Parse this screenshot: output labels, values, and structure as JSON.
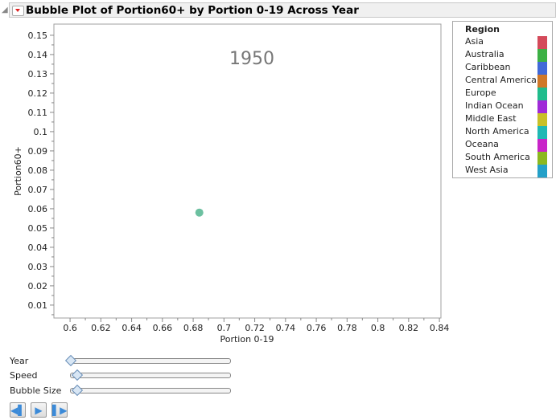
{
  "header": {
    "title": "Bubble Plot of Portion60+  by Portion 0-19 Across Year"
  },
  "chart_data": {
    "type": "scatter",
    "title": "Bubble Plot of Portion60+  by Portion 0-19 Across Year",
    "annotation": "1950",
    "xlabel": "Portion 0-19",
    "ylabel": "Portion60+",
    "xlim": [
      0.5895,
      0.841
    ],
    "ylim": [
      0.0033,
      0.1558
    ],
    "xticks": [
      "0.6",
      "0.62",
      "0.64",
      "0.66",
      "0.68",
      "0.7",
      "0.72",
      "0.74",
      "0.76",
      "0.78",
      "0.8",
      "0.82",
      "0.84"
    ],
    "yticks": [
      "0.01",
      "0.02",
      "0.03",
      "0.04",
      "0.05",
      "0.06",
      "0.07",
      "0.08",
      "0.09",
      "0.1",
      "0.11",
      "0.12",
      "0.13",
      "0.14",
      "0.15"
    ],
    "points": [
      {
        "x": 0.684,
        "y": 0.058,
        "region": "Europe",
        "color": "#6cc0a0"
      }
    ]
  },
  "legend": {
    "title": "Region",
    "items": [
      {
        "label": "Asia",
        "color": "#d44a5a"
      },
      {
        "label": "Australia",
        "color": "#3cb044"
      },
      {
        "label": "Caribbean",
        "color": "#4169d8"
      },
      {
        "label": "Central America",
        "color": "#d07828"
      },
      {
        "label": "Europe",
        "color": "#20bc8c"
      },
      {
        "label": "Indian Ocean",
        "color": "#a02ad8"
      },
      {
        "label": "Middle East",
        "color": "#c8c028"
      },
      {
        "label": "North America",
        "color": "#20b8b4"
      },
      {
        "label": "Oceana",
        "color": "#c824c8"
      },
      {
        "label": "South America",
        "color": "#8cb820"
      },
      {
        "label": "West Asia",
        "color": "#24a0c8"
      }
    ]
  },
  "controls": {
    "year": "Year",
    "speed": "Speed",
    "bubble_size": "Bubble Size",
    "year_value": 0,
    "speed_value": 0.04,
    "bubble_size_value": 0.04
  }
}
